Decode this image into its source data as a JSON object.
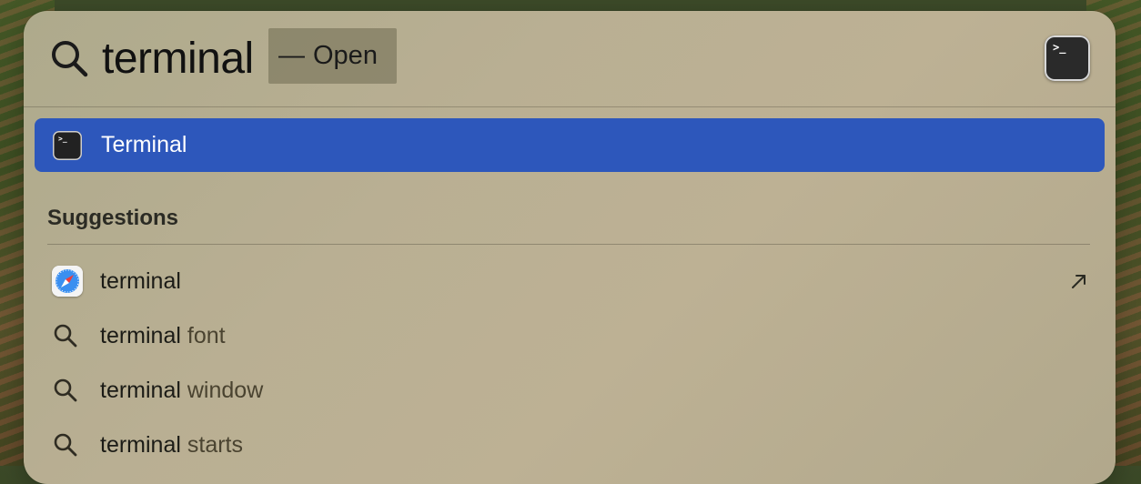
{
  "search": {
    "query": "terminal",
    "completion_dash": "—",
    "completion_action": "Open"
  },
  "top_hit": {
    "label": "Terminal",
    "icon": "terminal-app-icon",
    "highlight_color": "#2d57bb"
  },
  "suggestions": {
    "title": "Suggestions",
    "items": [
      {
        "prefix": "terminal",
        "suffix": "",
        "icon": "safari-icon",
        "trailing": "open-arrow-icon"
      },
      {
        "prefix": "terminal",
        "suffix": " font",
        "icon": "search-icon"
      },
      {
        "prefix": "terminal",
        "suffix": " window",
        "icon": "search-icon"
      },
      {
        "prefix": "terminal",
        "suffix": " starts",
        "icon": "search-icon"
      }
    ]
  }
}
